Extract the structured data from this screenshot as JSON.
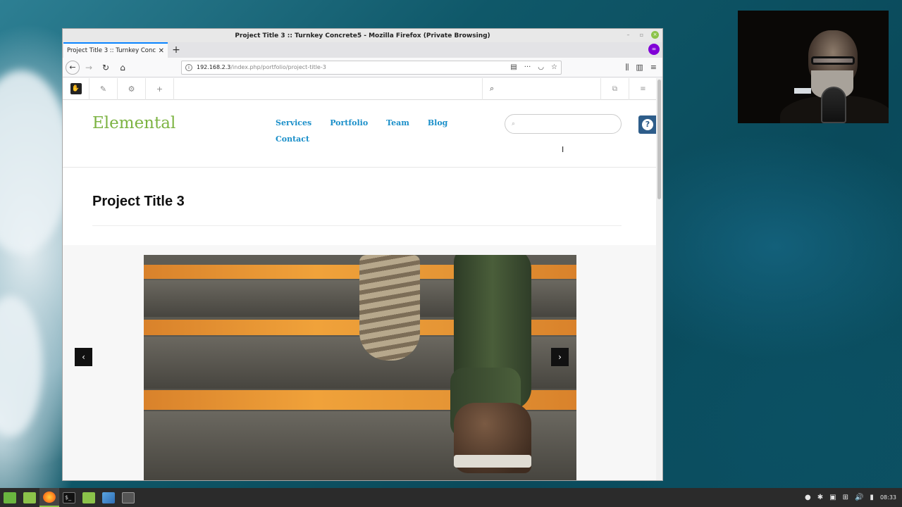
{
  "window": {
    "title": "Project Title 3 :: Turnkey Concrete5 - Mozilla Firefox (Private Browsing)",
    "minimize_icon": "–",
    "maximize_icon": "▫",
    "close_icon": "×"
  },
  "tabs": [
    {
      "label": "Project Title 3 :: Turnkey Concrete",
      "close": "✕"
    }
  ],
  "new_tab_label": "+",
  "private_icon": "∞",
  "url": {
    "host": "192.168.2.3",
    "path": "/index.php/portfolio/project-title-3"
  },
  "nav_icons": {
    "back": "←",
    "forward": "→",
    "reload": "↻",
    "home": "⌂",
    "reader": "▤",
    "more": "···",
    "pocket": "◡",
    "bookmark": "☆",
    "library": "⫼",
    "sidebar": "▥",
    "menu": "≡"
  },
  "c5_toolbar": {
    "logo": "✋",
    "edit": "✎",
    "settings": "⚙",
    "add": "+",
    "search_icon": "⌕",
    "dashboard": "⧉",
    "panel": "≡"
  },
  "site": {
    "logo": "Elemental",
    "nav": [
      "Services",
      "Portfolio",
      "Team",
      "Blog",
      "Contact"
    ],
    "search_icon": "⌕",
    "help": "?"
  },
  "page": {
    "title": "Project Title 3"
  },
  "gallery": {
    "prev": "‹",
    "next": "›"
  },
  "taskbar": {
    "terminal_label": "$_",
    "tray_icons": [
      "●",
      "✱",
      "▣",
      "⊞",
      "🔊",
      "▮"
    ],
    "clock": "08:33"
  },
  "colors": {
    "logo": "#7cb342",
    "nav_link": "#1a8fc9",
    "help_button": "#2e5d8a",
    "accent_tab": "#0a84ff"
  }
}
